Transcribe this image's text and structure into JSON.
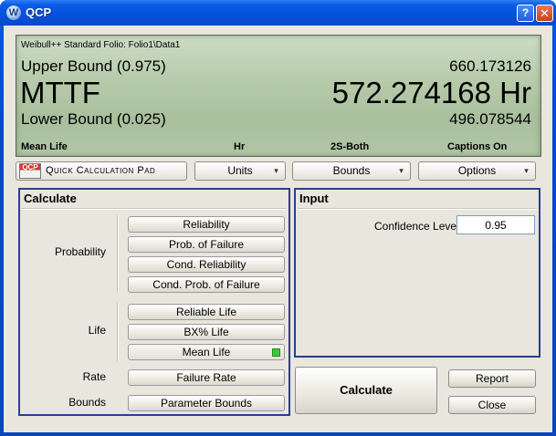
{
  "window": {
    "title": "QCP",
    "help_glyph": "?",
    "close_glyph": "✕",
    "app_icon_letter": "W"
  },
  "display": {
    "path": "Weibull++ Standard Folio: Folio1\\Data1",
    "upper_label": "Upper Bound (0.975)",
    "upper_value": "660.173126",
    "main_label": "MTTF",
    "main_value": "572.274168 Hr",
    "lower_label": "Lower Bound (0.025)",
    "lower_value": "496.078544",
    "footer": {
      "mode": "Mean Life",
      "unit": "Hr",
      "bounds": "2S-Both",
      "captions": "Captions On"
    }
  },
  "toolbar": {
    "qcp_logo_text": "QCP",
    "qcp_label": "Quick Calculation Pad",
    "units": "Units",
    "bounds": "Bounds",
    "options": "Options",
    "chevron": "▾"
  },
  "calculate": {
    "title": "Calculate",
    "probability_label": "Probability",
    "life_label": "Life",
    "rate_label": "Rate",
    "bounds_label": "Bounds",
    "buttons": {
      "reliability": "Reliability",
      "prob_failure": "Prob. of Failure",
      "cond_reliability": "Cond. Reliability",
      "cond_prob_failure": "Cond. Prob. of Failure",
      "reliable_life": "Reliable Life",
      "bx_life": "BX% Life",
      "mean_life": "Mean Life",
      "failure_rate": "Failure Rate",
      "parameter_bounds": "Parameter Bounds"
    },
    "selected": "mean_life"
  },
  "input": {
    "title": "Input",
    "confidence_label": "Confidence Level",
    "confidence_value": "0.95"
  },
  "actions": {
    "calculate": "Calculate",
    "report": "Report",
    "close": "Close"
  }
}
